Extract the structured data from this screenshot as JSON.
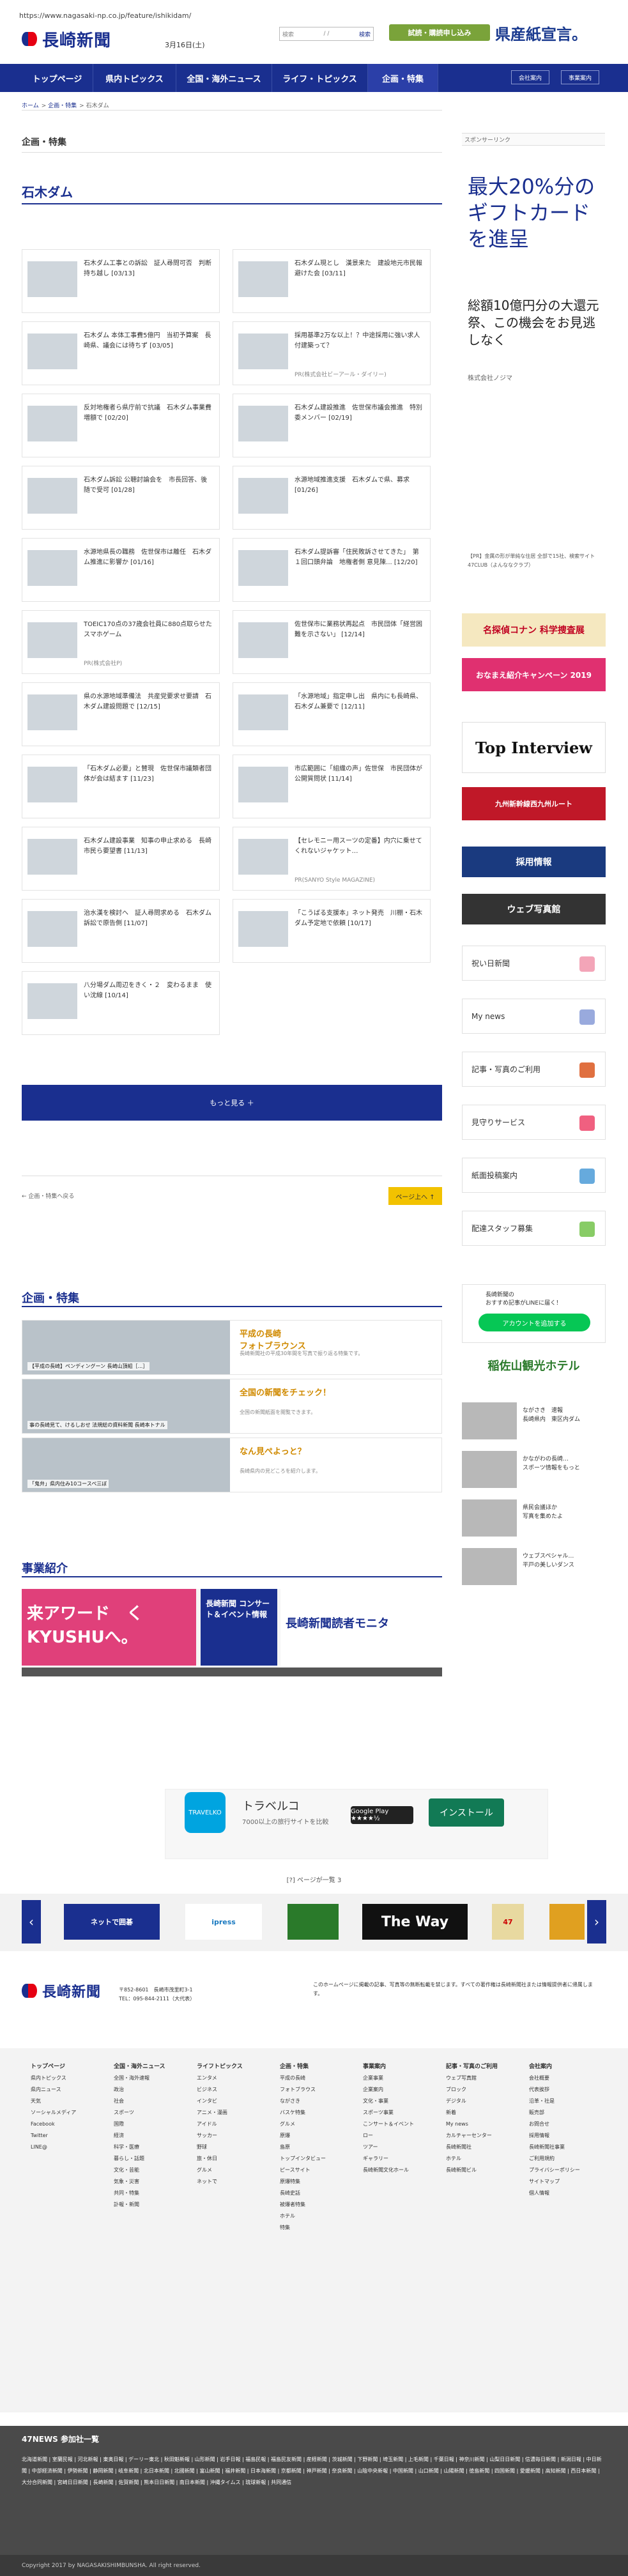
{
  "url": "https://www.nagasaki-np.co.jp/feature/ishikidam/",
  "header": {
    "logo": "長崎新聞",
    "date": "3月16日(土)",
    "search_label": "検索",
    "search_range": "/ /",
    "search_go": "検索",
    "trial": "試読・購読申し込み",
    "promo": "県産紙宣言。"
  },
  "nav": {
    "items": [
      "トップページ",
      "県内トピックス",
      "全国・海外ニュース",
      "ライフ・トピックス",
      "企画・特集"
    ],
    "right": [
      "会社案内",
      "事業案内"
    ]
  },
  "breadcrumb": [
    "ホーム",
    "企画・特集",
    "石木ダム"
  ],
  "section_label": "企画・特集",
  "page_title": "石木ダム",
  "cards": [
    {
      "text": "石木ダム工事との訴訟　証人尋問可否　判断持ち越し [03/13]",
      "sub": ""
    },
    {
      "text": "石木ダム現とし　漢景来た　建設地元市民報避けた会 [03/11]",
      "sub": ""
    },
    {
      "text": "石木ダム 本体工事費5億円　当初予算案　長崎県、議会には待ちず [03/05]",
      "sub": ""
    },
    {
      "text": "採用基準2万な以上！？中途採用に強い求人付建築って？",
      "sub": "PR(株式会社ビーアール・ダイリー)"
    },
    {
      "text": "反対地権者ら県庁前で抗議　石木ダム事業費増額で [02/20]",
      "sub": ""
    },
    {
      "text": "石木ダム建設推進　佐世保市議会推進　特別委メンバー [02/19]",
      "sub": ""
    },
    {
      "text": "石木ダム訴訟 公聴討論会を　市長回答、後随で受可 [01/28]",
      "sub": ""
    },
    {
      "text": "水源地域推進支援　石木ダムで県、募求 [01/26]",
      "sub": ""
    },
    {
      "text": "水源地県長の職務　佐世保市は離任　石木ダム推進に影響か [01/16]",
      "sub": ""
    },
    {
      "text": "石木ダム提訴審「住民敗訴させてきた」　第１回口頭弁論　地権者側 意見陳... [12/20]",
      "sub": ""
    },
    {
      "text": "TOEIC170点の37歳会社員に880点取らせたスマホゲーム",
      "sub": "PR(株式会社P)"
    },
    {
      "text": "佐世保市に業務状再起点　市民団体「経営困難を示さない」 [12/14]",
      "sub": ""
    },
    {
      "text": "県の水源地域準備法　共産党要求せ要請　石木ダム建設問題で [12/15]",
      "sub": ""
    },
    {
      "text": "「水源地域」指定申し出　県内にも長崎県、石木ダム兼要で [12/11]",
      "sub": ""
    },
    {
      "text": "「石木ダム必要」と賛現　佐世保市議類者団体が会は結ます [11/23]",
      "sub": ""
    },
    {
      "text": "市広範囲に「組織の声」佐世保　市民団体が公開質問状 [11/14]",
      "sub": ""
    },
    {
      "text": "石木ダム建設事業　知事の申止求める　長崎市民ら要望書 [11/13]",
      "sub": ""
    },
    {
      "text": "【セレモニー用スーツの定番】内穴に乗せてくれないジャケット…",
      "sub": "PR(SANYO Style MAGAZINE)"
    },
    {
      "text": "治水漢を検討へ　証人尋問求める　石木ダム訴訟で原告側 [11/07]",
      "sub": ""
    },
    {
      "text": "「こうばる支援本」ネット発売　川棚・石木ダム予定地で依頼 [10/17]",
      "sub": ""
    },
    {
      "text": "八分場ダム周辺をきく・２　変わるまま　使い沈線 [10/14]",
      "sub": ""
    }
  ],
  "more_button": "もっと見る ＋",
  "pager": {
    "left": "← 企画・特集へ戻る",
    "right": "ページ上へ ↑"
  },
  "features_head": "企画・特集",
  "features": [
    {
      "title": "平成の長崎\nフォトブラウンス",
      "caption": "【平成の長崎】ペンディングーン 長崎山頂組［...］",
      "desc": "長崎新聞社の平成30年間を写真で振り返る特集です。"
    },
    {
      "title": "全国の新聞をチェック！",
      "caption": "事の長崎見て、けるしおせ 法規総の資料新聞 長崎本トナル",
      "desc": "全国の新聞紙面を閲覧できます。"
    },
    {
      "title": "なん見ぺよっと？",
      "caption": "「鬼弁」県内住み10コースペ三ぼ",
      "desc": "長崎県内の見どころを紹介します。"
    }
  ],
  "biz_head": "事業紹介",
  "biz": [
    "来アワード　くKYUSHUへ。",
    "長崎新聞 コンサート＆イベント情報",
    "長崎新聞読者モニタ"
  ],
  "ad": {
    "title": "トラベルコ",
    "sub": "7000以上の旅行サイトを比較",
    "gp": "Google Play ★★★★½",
    "install": "インストール"
  },
  "banner_head": "[?] ページが一覧 3",
  "banners": [
    "ネットで囲碁",
    "ipress",
    "",
    "The Way",
    "47",
    ""
  ],
  "footer": {
    "logo": "長崎新聞",
    "addr": "〒852-8601　長崎市茂里町3-1\nTEL：095-844-2111（大代表）",
    "notice": "このホームページに掲載の記事、写真等の無断転載を禁じます。すべての著作権は長崎新聞社または情報提供者に帰属します。",
    "cols": [
      {
        "h": "トップページ",
        "items": [
          "県内トピックス",
          "県内ニュース",
          "天気",
          "ソーシャルメディア",
          "Facebook",
          "Twitter",
          "LINE@"
        ]
      },
      {
        "h": "全国・海外ニュース",
        "items": [
          "全国・海外速報",
          "政治",
          "社会",
          "スポーツ",
          "国際",
          "経済",
          "科学・医療",
          "暮らし・話題",
          "文化・芸能",
          "気象・災害",
          "共同・特集",
          "訃報・新聞"
        ]
      },
      {
        "h": "ライフトピックス",
        "items": [
          "エンタメ",
          "ビジネス",
          "インタビ",
          "アニメ・漫画",
          "アイドル",
          "サッカー",
          "野球",
          "旅・休日",
          "グルメ",
          "ネットで"
        ]
      },
      {
        "h": "企画・特集",
        "items": [
          "平成の長崎",
          "フォトブラウス",
          "ながさき",
          "バスケ特集",
          "グルメ",
          "原爆",
          "島原",
          "トップインタビュー",
          "ピースサイト",
          "原爆特集",
          "長崎史話",
          "被爆者特集",
          "ホテル",
          "特集"
        ]
      },
      {
        "h": "事業案内",
        "items": [
          "企業事業",
          "企業案内",
          "文化・事業",
          "スポーツ事業",
          "こンサート＆イベント",
          "ロー",
          "ツアー",
          "ギャラリー",
          "長崎新聞文化ホール"
        ]
      },
      {
        "h": "記事・写真のご利用",
        "items": [
          "ウェブ写真館",
          "ブロック",
          "デジタル",
          "新着",
          "My news",
          "カルチャーセンター",
          "長崎新聞社",
          "ホテル",
          "長崎新聞ビル"
        ]
      },
      {
        "h": "会社案内",
        "items": [
          "会社概要",
          "代表挨拶",
          "沿革・社是",
          "販売部",
          "お問合せ",
          "採用情報",
          "長崎新聞社事業",
          "ご利用規約",
          "プライバシーポリシー",
          "サイトマップ",
          "個人情報"
        ]
      }
    ]
  },
  "news47": {
    "head": "47NEWS 参加社一覧",
    "links": "北海道新聞 | 室蘭民報 | 河北新報 | 東奥日報 | デーリー東北 | 秋田魁新報 | 山形新聞 | 岩手日報 | 福島民報 | 福島民友新聞 | 産経新聞 | 茨城新聞 | 下野新聞 | 埼玉新聞 | 上毛新聞 | 千葉日報 | 神奈川新聞 | 山梨日日新聞 | 信濃毎日新聞 | 新潟日報 | 中日新聞 | 中部経済新聞 | 伊勢新聞 | 静岡新聞 | 岐阜新聞 | 北日本新聞 | 北國新聞 | 富山新聞 | 福井新聞 | 日本海新聞 | 京都新聞 | 神戸新聞 | 奈良新聞 | 山陰中央新報 | 中国新聞 | 山口新聞 | 山陽新聞 | 徳島新聞 | 四国新聞 | 愛媛新聞 | 高知新聞 | 西日本新聞 | 大分合同新聞 | 宮崎日日新聞 | 長崎新聞 | 佐賀新聞 | 熊本日日新聞 | 南日本新聞 | 沖縄タイムス | 琉球新報 | 共同通信"
  },
  "copyright": "Copyright 2017 by NAGASAKISHIMBUNSHA. All right reserved.",
  "sidebar": {
    "label": "スポンサーリンク",
    "gift": "最大20%分のギフトカードを進呈",
    "gift_sub": "総額10億円分の大還元祭、この機会をお見逃しなく",
    "gift_brand": "株式会社ノジマ",
    "note": "【PR】金属の形が単純な住居 全部で15社、検索サイト 47CLUB（よんななクラブ）",
    "banners": [
      "名探偵コナン 科学捜査展",
      "おなまえ紹介キャンペーン 2019",
      "Top Interview",
      "九州新幹線西九州ルート",
      "採用情報",
      "ウェブ写真館"
    ],
    "buttons": [
      "祝い日新聞",
      "My news",
      "記事・写真のご利用",
      "見守りサービス",
      "紙面投稿案内",
      "配達スタッフ募集"
    ],
    "line_text": "長崎新聞の\nおすすめ記事がLINEに届く！",
    "line_btn": "アカウントを追加する",
    "hotel": "稲佐山観光ホテル",
    "news": [
      "ながさき　速報\n長崎県内　東区内ダム",
      "かながわの長崎…\nスポーツ情報をもっと",
      "県民会議ほか\n写真を集めたよ",
      "ウェブスペシャル…\n平戸の美しいダンス"
    ]
  }
}
